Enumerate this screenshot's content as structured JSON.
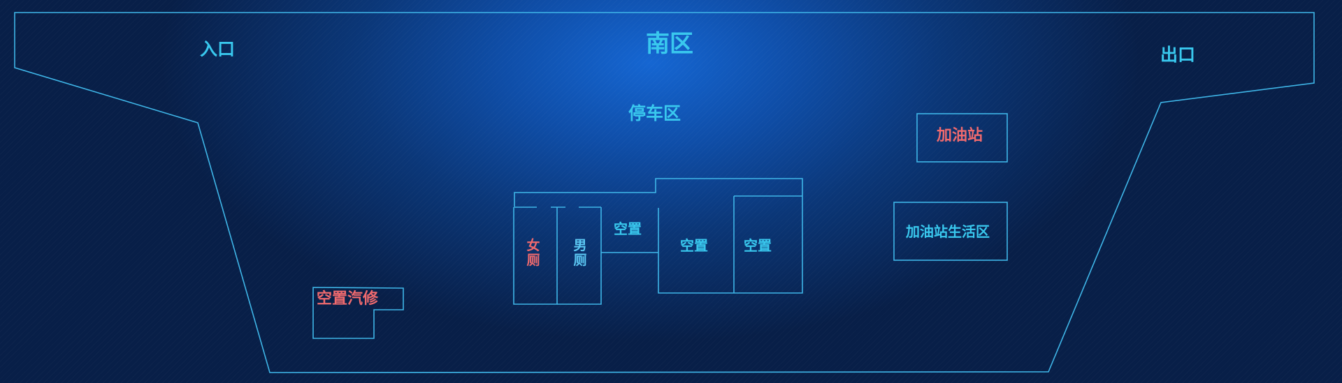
{
  "title": "南区",
  "labels": {
    "entrance": "入口",
    "exit": "出口",
    "parking": "停车区",
    "gas_station": "加油站",
    "gas_living": "加油站生活区",
    "vacant_repair": "空置汽修",
    "women_toilet": [
      "女",
      "厕"
    ],
    "men_toilet": [
      "男",
      "厕"
    ],
    "vacant_1": "空置",
    "vacant_2": "空置",
    "vacant_3": "空置"
  },
  "colors": {
    "outline": "#3fb6e8",
    "label": "#39c8ee",
    "highlight": "#ef6a6e"
  }
}
